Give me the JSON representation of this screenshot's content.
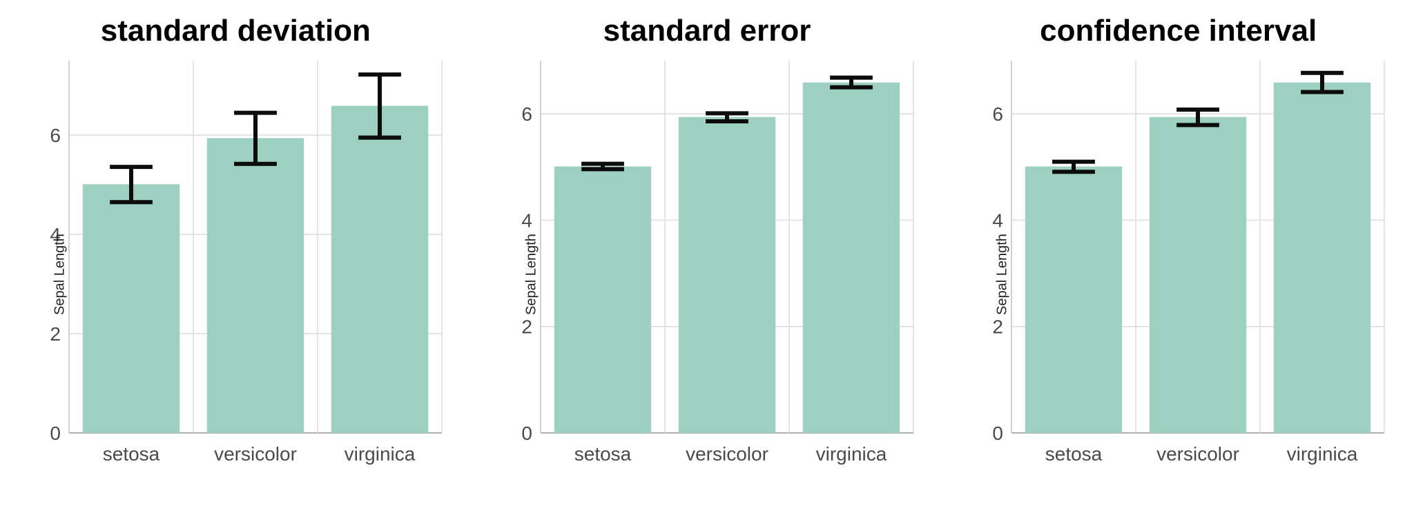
{
  "chart_data": [
    {
      "type": "bar",
      "title": "standard deviation",
      "ylabel": "Sepal Length",
      "xlabel": "",
      "categories": [
        "setosa",
        "versicolor",
        "virginica"
      ],
      "values": [
        5.01,
        5.94,
        6.59
      ],
      "error_low": [
        4.65,
        5.42,
        5.95
      ],
      "error_high": [
        5.36,
        6.45,
        7.22
      ],
      "yticks": [
        0,
        2,
        4,
        6
      ],
      "ylim": [
        0,
        7.5
      ],
      "bar_color": "#9ed0c1",
      "error_color": "#0c0c0c"
    },
    {
      "type": "bar",
      "title": "standard error",
      "ylabel": "Sepal Length",
      "xlabel": "",
      "categories": [
        "setosa",
        "versicolor",
        "virginica"
      ],
      "values": [
        5.01,
        5.94,
        6.59
      ],
      "error_low": [
        4.96,
        5.86,
        6.5
      ],
      "error_high": [
        5.06,
        6.01,
        6.68
      ],
      "yticks": [
        0,
        2,
        4,
        6
      ],
      "ylim": [
        0,
        7.0
      ],
      "bar_color": "#9ed0c1",
      "error_color": "#0c0c0c"
    },
    {
      "type": "bar",
      "title": "confidence interval",
      "ylabel": "Sepal Length",
      "xlabel": "",
      "categories": [
        "setosa",
        "versicolor",
        "virginica"
      ],
      "values": [
        5.01,
        5.94,
        6.59
      ],
      "error_low": [
        4.91,
        5.79,
        6.41
      ],
      "error_high": [
        5.1,
        6.08,
        6.77
      ],
      "yticks": [
        0,
        2,
        4,
        6
      ],
      "ylim": [
        0,
        7.0
      ],
      "bar_color": "#9ed0c1",
      "error_color": "#0c0c0c"
    }
  ]
}
